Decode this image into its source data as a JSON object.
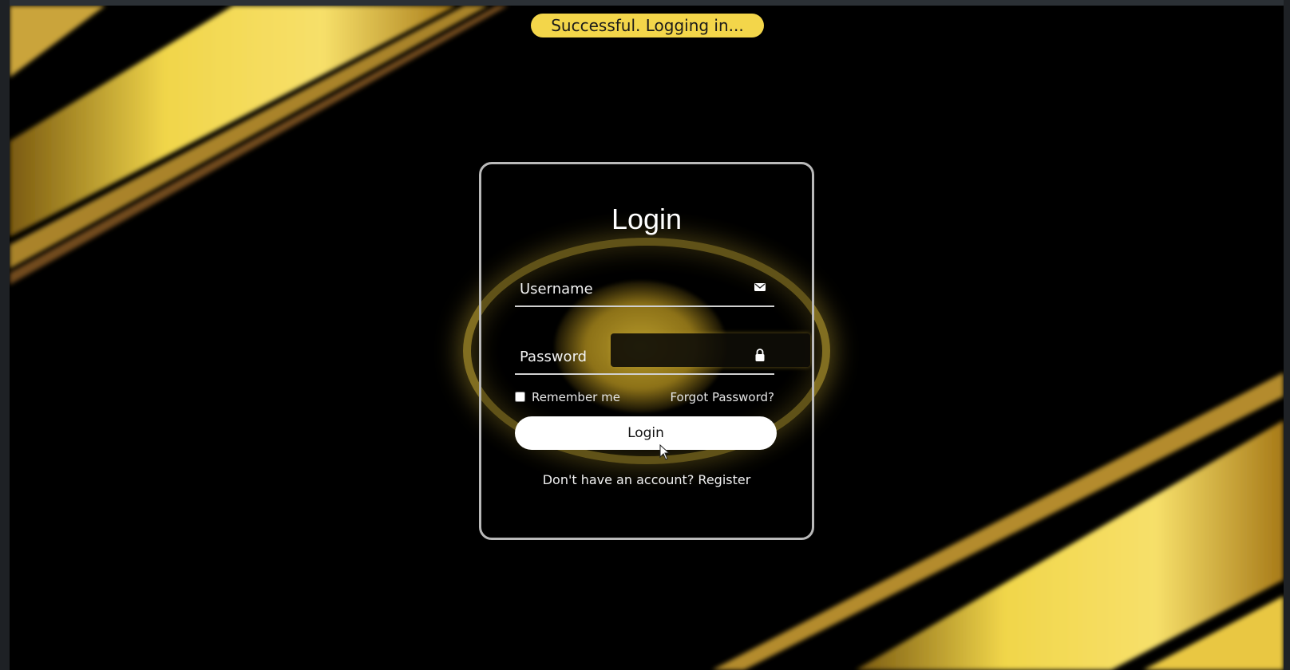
{
  "toast": {
    "text": "Successful. Logging in..."
  },
  "form": {
    "title": "Login",
    "username_placeholder": "Username",
    "password_placeholder": "Password",
    "remember_label": "Remember me",
    "forgot_label": "Forgot Password?",
    "submit_label": "Login",
    "register_prompt": "Don't have an account?",
    "register_link": "Register"
  },
  "icons": {
    "username": "envelope-icon",
    "password": "lock-icon"
  },
  "colors": {
    "accent": "#f3d64a",
    "background": "#000000",
    "card_border": "#b9b9b9"
  }
}
